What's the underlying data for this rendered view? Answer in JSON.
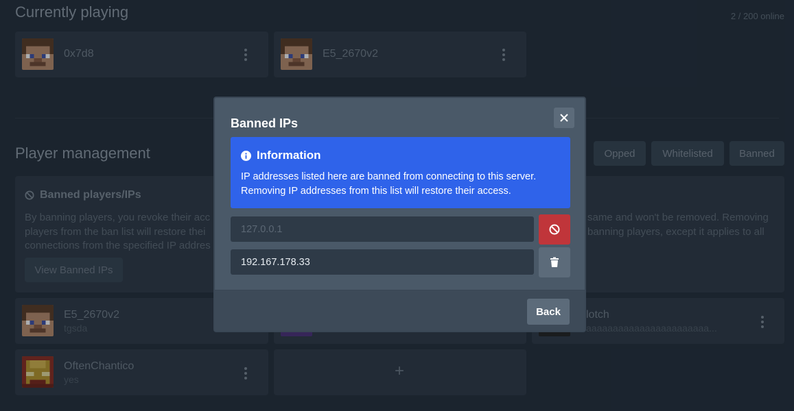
{
  "header": {
    "title": "Currently playing",
    "online_count": "2 / 200 online"
  },
  "playing": [
    {
      "name": "0x7d8"
    },
    {
      "name": "E5_2670v2"
    }
  ],
  "management": {
    "title": "Player management",
    "filters": [
      "Opped",
      "Whitelisted",
      "Banned"
    ],
    "banned_card": {
      "title": "Banned players/IPs",
      "text_left_lines": [
        "By banning players, you revoke their acc",
        "players from the ban list will restore thei",
        "connections from the specified IP addres"
      ],
      "text_right_lines": [
        "same and won't be removed. Removing",
        "banning players, except it applies to all"
      ],
      "view_button": "View Banned IPs"
    },
    "players": [
      {
        "name": "E5_2670v2",
        "note": "tgsda"
      },
      {
        "name": "lotch",
        "note": "aaaaaaaaaaaaaaaaaaaaaaa..."
      },
      {
        "name": "OftenChantico",
        "note": "yes"
      }
    ],
    "add_label": "+"
  },
  "modal": {
    "title": "Banned IPs",
    "info_title": "Information",
    "info_text": "IP addresses listed here are banned from connecting to this server. Removing IP addresses from this list will restore their access.",
    "ips": [
      {
        "value": "127.0.0.1",
        "action": "ban-icon",
        "disabled": true
      },
      {
        "value": "192.167.178.33",
        "action": "trash-icon",
        "disabled": false
      }
    ],
    "back_label": "Back"
  },
  "colors": {
    "accent": "#2f63ea",
    "danger": "#c0353a",
    "background": "#212c38"
  }
}
